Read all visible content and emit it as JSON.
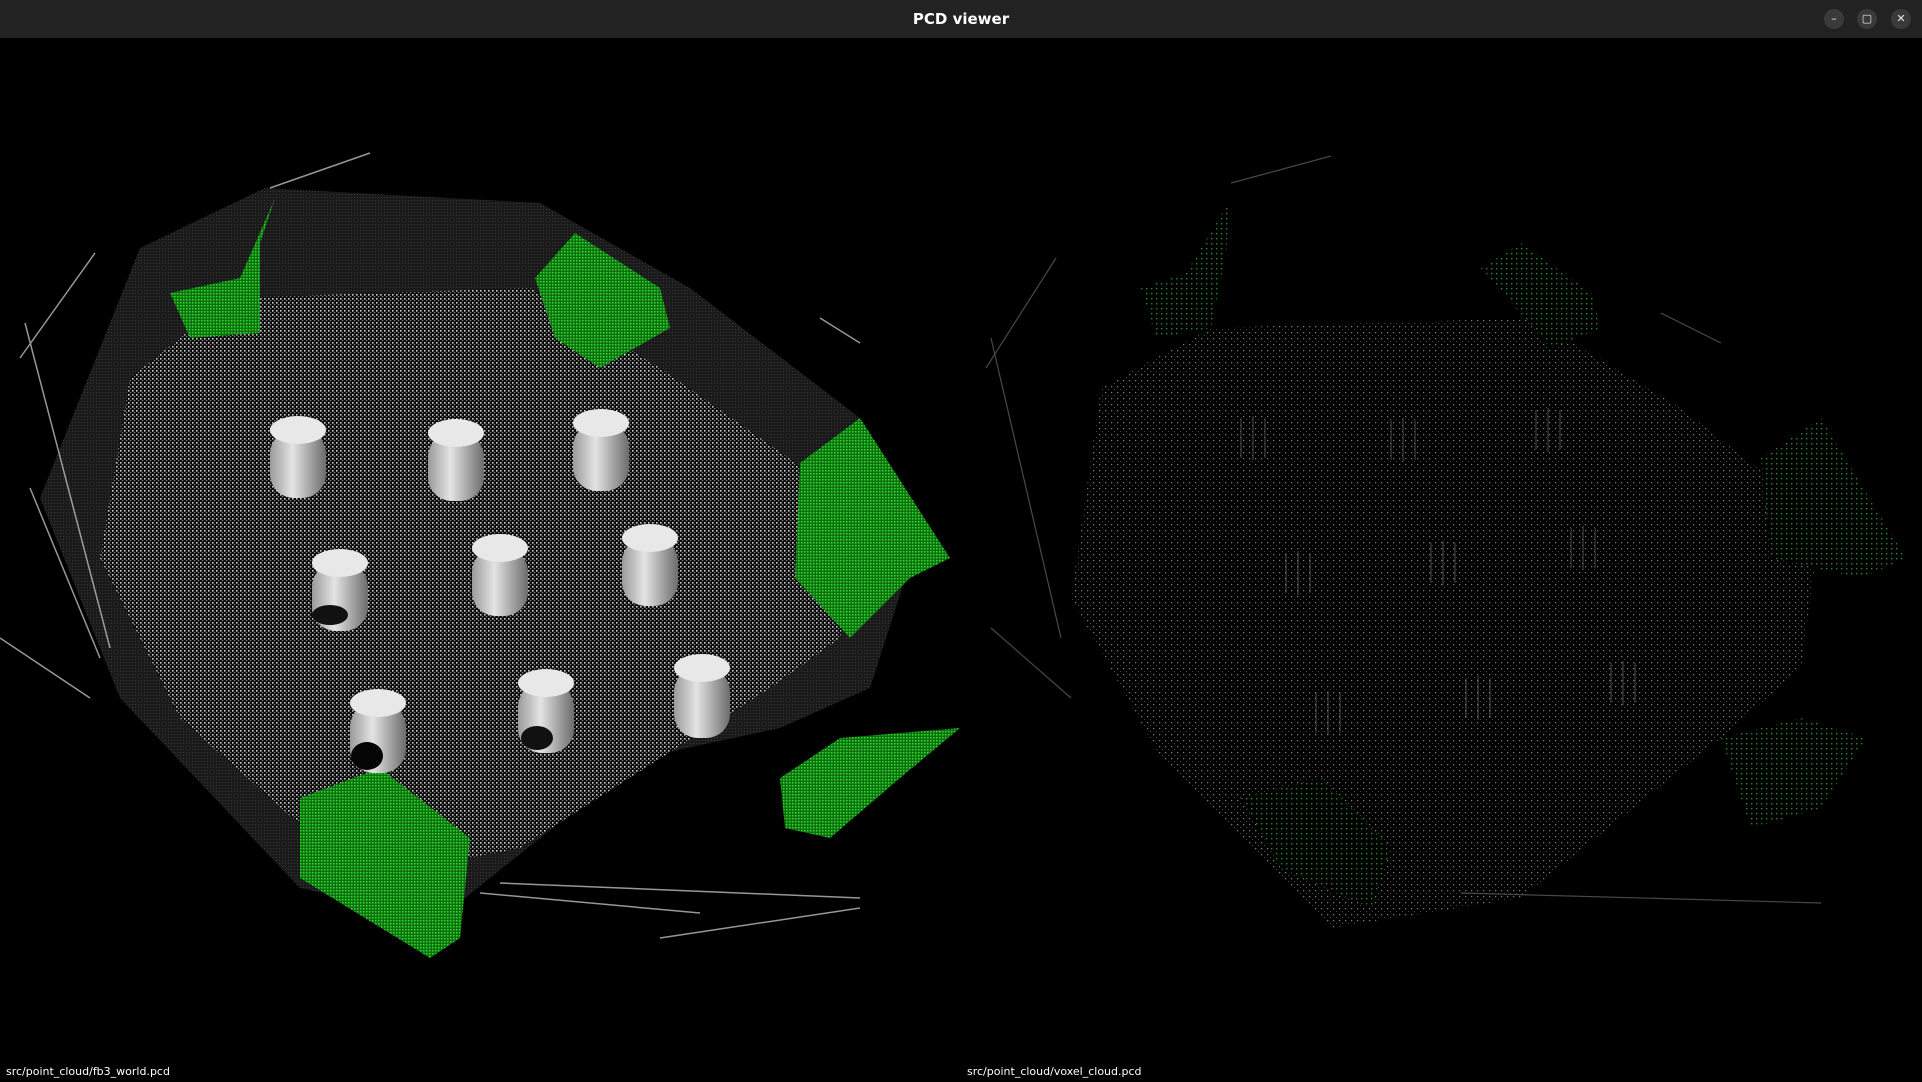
{
  "window": {
    "title": "PCD viewer",
    "controls": {
      "minimize": "–",
      "maximize": "▢",
      "close": "✕"
    }
  },
  "viewports": {
    "left": {
      "file_label": "src/point_cloud/fb3_world.pcd"
    },
    "right": {
      "file_label": "src/point_cloud/voxel_cloud.pcd"
    }
  },
  "colors": {
    "background": "#000000",
    "floor_points": "#d8d8d8",
    "wall_points": "#1ecf1e",
    "dim_points": "#6a6a6a"
  }
}
